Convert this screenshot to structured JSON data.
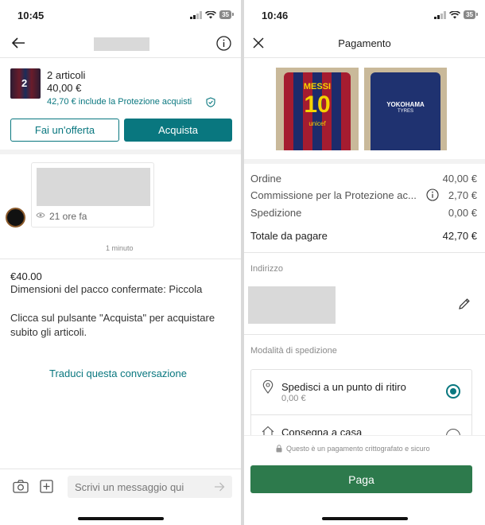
{
  "left": {
    "status": {
      "time": "10:45",
      "battery": "35"
    },
    "item": {
      "count": "2 articoli",
      "price": "40,00 €",
      "protection": "42,70 € include la Protezione acquisti",
      "thumb_number": "2"
    },
    "buttons": {
      "offer": "Fai un'offerta",
      "buy": "Acquista"
    },
    "message_card": {
      "views": "21 ore fa"
    },
    "time_divider": "1 minuto",
    "system_message": {
      "amount": "€40.00",
      "line1": "Dimensioni del pacco confermate: Piccola",
      "line2": "Clicca sul pulsante \"Acquista\" per acquistare",
      "line3": "subito gli articoli."
    },
    "translate_link": "Traduci questa conversazione",
    "composer": {
      "placeholder": "Scrivi un messaggio qui"
    }
  },
  "right": {
    "status": {
      "time": "10:46",
      "battery": "35"
    },
    "header": {
      "title": "Pagamento"
    },
    "jersey1": {
      "name": "MESSI",
      "number": "10",
      "brand": "unicef"
    },
    "jersey2": {
      "sponsor": "YOKOHAMA",
      "sponsor_sub": "TYRES"
    },
    "summary": {
      "order_label": "Ordine",
      "order_value": "40,00 €",
      "fee_label": "Commissione per la Protezione ac...",
      "fee_value": "2,70 €",
      "shipping_label": "Spedizione",
      "shipping_value": "0,00 €",
      "total_label": "Totale da pagare",
      "total_value": "42,70 €"
    },
    "address": {
      "label": "Indirizzo"
    },
    "shipping": {
      "label": "Modalità di spedizione",
      "option1_title": "Spedisci a un punto di ritiro",
      "option1_price": "0,00 €",
      "option2_title": "Consegna a casa"
    },
    "secure_note": "Questo è un pagamento crittografato e sicuro",
    "pay_button": "Paga"
  },
  "colors": {
    "accent": "#09777f",
    "pay_green": "#2d7a4c",
    "placeholder_grey": "#d9d9d9"
  }
}
